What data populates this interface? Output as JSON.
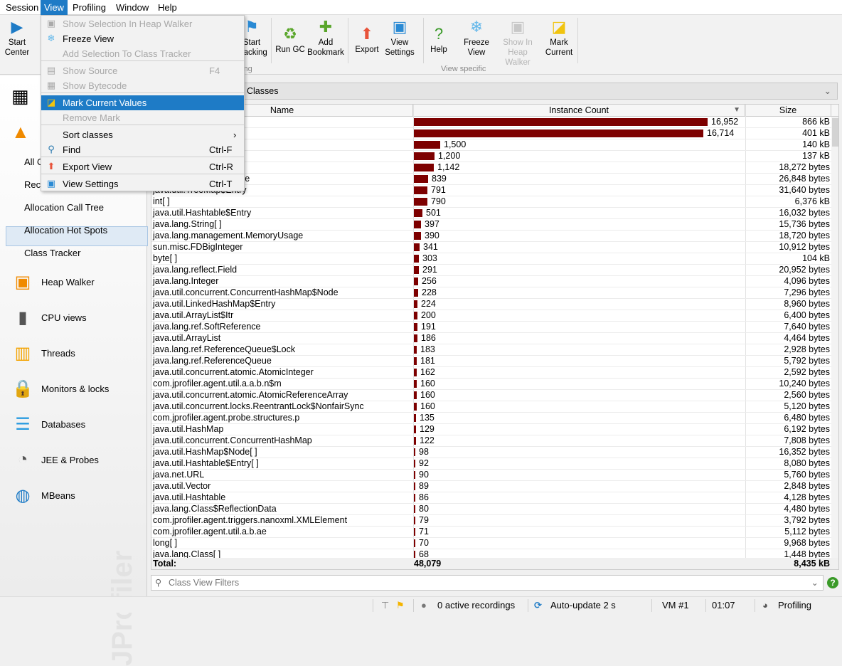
{
  "menubar": {
    "items": [
      "Session",
      "View",
      "Profiling",
      "Window",
      "Help"
    ],
    "active": "View"
  },
  "toolbar": {
    "buttons": [
      {
        "label1": "Start",
        "label2": "Center",
        "icon": "start-center-icon",
        "enabled": true
      },
      {
        "label1": "Start",
        "label2": "Tracking",
        "icon": "start-tracking-icon",
        "enabled": true
      },
      {
        "label1": "Run GC",
        "label2": "",
        "icon": "run-gc-icon",
        "enabled": true
      },
      {
        "label1": "Add",
        "label2": "Bookmark",
        "icon": "bookmark-icon",
        "enabled": true
      },
      {
        "label1": "Export",
        "label2": "",
        "icon": "export-icon",
        "enabled": true
      },
      {
        "label1": "View",
        "label2": "Settings",
        "icon": "view-settings-icon",
        "enabled": true
      },
      {
        "label1": "Help",
        "label2": "",
        "icon": "help-icon",
        "enabled": true
      },
      {
        "label1": "Freeze",
        "label2": "View",
        "icon": "snowflake-icon",
        "enabled": true
      },
      {
        "label1": "Show In",
        "label2": "Heap Walker",
        "icon": "camera-icon",
        "enabled": false
      },
      {
        "label1": "Mark",
        "label2": "Current",
        "icon": "sticky-note-icon",
        "enabled": true
      }
    ],
    "groups": [
      "Profiling",
      "View specific"
    ]
  },
  "view_menu": {
    "items": [
      {
        "label": "Show Selection In Heap Walker",
        "shortcut": "",
        "enabled": false,
        "icon": "camera-icon"
      },
      {
        "label": "Freeze View",
        "shortcut": "",
        "enabled": true,
        "icon": "snowflake-icon"
      },
      {
        "label": "Add Selection To Class Tracker",
        "shortcut": "",
        "enabled": false,
        "icon": ""
      },
      {
        "label": "Show Source",
        "shortcut": "F4",
        "enabled": false,
        "icon": "source-icon"
      },
      {
        "label": "Show Bytecode",
        "shortcut": "",
        "enabled": false,
        "icon": "bytecode-icon"
      },
      {
        "label": "Mark Current Values",
        "shortcut": "",
        "enabled": true,
        "icon": "sticky-note-icon",
        "highlighted": true
      },
      {
        "label": "Remove Mark",
        "shortcut": "",
        "enabled": false,
        "icon": ""
      },
      {
        "label": "Sort classes",
        "shortcut": "›",
        "enabled": true,
        "icon": ""
      },
      {
        "label": "Find",
        "shortcut": "Ctrl-F",
        "enabled": true,
        "icon": "search-icon"
      },
      {
        "label": "Export View",
        "shortcut": "Ctrl-R",
        "enabled": true,
        "icon": "export-icon"
      },
      {
        "label": "View Settings",
        "shortcut": "Ctrl-T",
        "enabled": true,
        "icon": "view-settings-icon"
      }
    ]
  },
  "sidebar": {
    "sub_items": [
      "All Objects",
      "Recorded Objects",
      "Allocation Call Tree",
      "Allocation Hot Spots",
      "Class Tracker"
    ],
    "selected": "All Objects",
    "sections": [
      "Heap Walker",
      "CPU views",
      "Threads",
      "Monitors & locks",
      "Databases",
      "JEE & Probes",
      "MBeans"
    ],
    "watermark": "JProfiler"
  },
  "aggregation": {
    "value": "Classes"
  },
  "table": {
    "columns": [
      "Name",
      "Instance Count",
      "Size"
    ],
    "sorted_column": "Instance Count",
    "sort_dir": "descending",
    "bar_color": "#7d0000",
    "rows": [
      [
        "",
        16952,
        "16,952",
        "866 kB"
      ],
      [
        "",
        16714,
        "16,714",
        "401 kB"
      ],
      [
        "",
        1500,
        "1,500",
        "140 kB"
      ],
      [
        "",
        1200,
        "1,200",
        "137 kB"
      ],
      [
        "",
        1142,
        "1,142",
        "18,272 bytes"
      ],
      [
        "java.util.HashMap$Node",
        839,
        "839",
        "26,848 bytes"
      ],
      [
        "java.util.TreeMap$Entry",
        791,
        "791",
        "31,640 bytes"
      ],
      [
        "int[ ]",
        790,
        "790",
        "6,376 kB"
      ],
      [
        "java.util.Hashtable$Entry",
        501,
        "501",
        "16,032 bytes"
      ],
      [
        "java.lang.String[ ]",
        397,
        "397",
        "15,736 bytes"
      ],
      [
        "java.lang.management.MemoryUsage",
        390,
        "390",
        "18,720 bytes"
      ],
      [
        "sun.misc.FDBigInteger",
        341,
        "341",
        "10,912 bytes"
      ],
      [
        "byte[ ]",
        303,
        "303",
        "104 kB"
      ],
      [
        "java.lang.reflect.Field",
        291,
        "291",
        "20,952 bytes"
      ],
      [
        "java.lang.Integer",
        256,
        "256",
        "4,096 bytes"
      ],
      [
        "java.util.concurrent.ConcurrentHashMap$Node",
        228,
        "228",
        "7,296 bytes"
      ],
      [
        "java.util.LinkedHashMap$Entry",
        224,
        "224",
        "8,960 bytes"
      ],
      [
        "java.util.ArrayList$Itr",
        200,
        "200",
        "6,400 bytes"
      ],
      [
        "java.lang.ref.SoftReference",
        191,
        "191",
        "7,640 bytes"
      ],
      [
        "java.util.ArrayList",
        186,
        "186",
        "4,464 bytes"
      ],
      [
        "java.lang.ref.ReferenceQueue$Lock",
        183,
        "183",
        "2,928 bytes"
      ],
      [
        "java.lang.ref.ReferenceQueue",
        181,
        "181",
        "5,792 bytes"
      ],
      [
        "java.util.concurrent.atomic.AtomicInteger",
        162,
        "162",
        "2,592 bytes"
      ],
      [
        "com.jprofiler.agent.util.a.a.b.n$m",
        160,
        "160",
        "10,240 bytes"
      ],
      [
        "java.util.concurrent.atomic.AtomicReferenceArray",
        160,
        "160",
        "2,560 bytes"
      ],
      [
        "java.util.concurrent.locks.ReentrantLock$NonfairSync",
        160,
        "160",
        "5,120 bytes"
      ],
      [
        "com.jprofiler.agent.probe.structures.p",
        135,
        "135",
        "6,480 bytes"
      ],
      [
        "java.util.HashMap",
        129,
        "129",
        "6,192 bytes"
      ],
      [
        "java.util.concurrent.ConcurrentHashMap",
        122,
        "122",
        "7,808 bytes"
      ],
      [
        "java.util.HashMap$Node[ ]",
        98,
        "98",
        "16,352 bytes"
      ],
      [
        "java.util.Hashtable$Entry[ ]",
        92,
        "92",
        "8,080 bytes"
      ],
      [
        "java.net.URL",
        90,
        "90",
        "5,760 bytes"
      ],
      [
        "java.util.Vector",
        89,
        "89",
        "2,848 bytes"
      ],
      [
        "java.util.Hashtable",
        86,
        "86",
        "4,128 bytes"
      ],
      [
        "java.lang.Class$ReflectionData",
        80,
        "80",
        "4,480 bytes"
      ],
      [
        "com.jprofiler.agent.triggers.nanoxml.XMLElement",
        79,
        "79",
        "3,792 bytes"
      ],
      [
        "com.jprofiler.agent.util.a.b.ae",
        71,
        "71",
        "5,112 bytes"
      ],
      [
        "long[ ]",
        70,
        "70",
        "9,968 bytes"
      ],
      [
        "java.lang.Class[ ]",
        68,
        "68",
        "1,448 bytes"
      ]
    ],
    "total": {
      "label": "Total:",
      "count": "48,079",
      "size": "8,435 kB"
    }
  },
  "filter": {
    "placeholder": "Class View Filters"
  },
  "status": {
    "recordings": "0 active recordings",
    "autoupdate": "Auto-update 2 s",
    "vm": "VM #1",
    "time": "01:07",
    "mode": "Profiling"
  }
}
